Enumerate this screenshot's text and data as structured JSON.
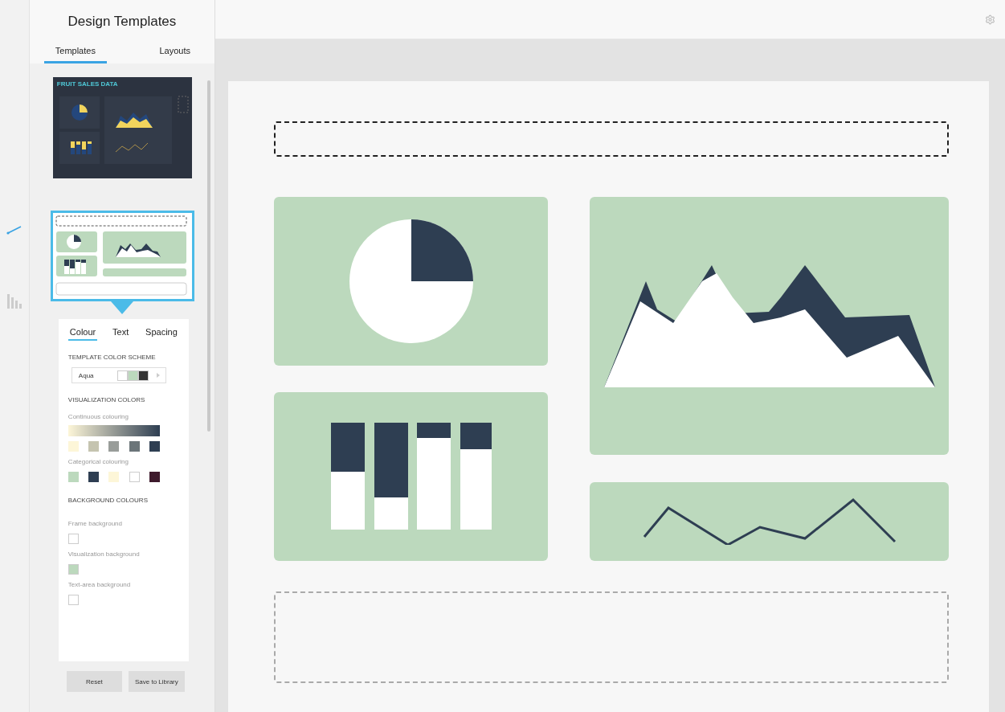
{
  "panel": {
    "title": "Design Templates",
    "tabs": [
      {
        "label": "Templates",
        "selected": true
      },
      {
        "label": "Layouts",
        "selected": false
      }
    ]
  },
  "templates": [
    {
      "kind": "dark",
      "title": "FRUIT SALES DATA",
      "selected": false
    },
    {
      "kind": "light",
      "selected": true
    }
  ],
  "settings": {
    "tabs": [
      {
        "label": "Colour",
        "selected": true
      },
      {
        "label": "Text",
        "selected": false
      },
      {
        "label": "Spacing",
        "selected": false
      }
    ],
    "scheme_heading": "TEMPLATE COLOR SCHEME",
    "scheme": {
      "name": "Aqua",
      "swatches": [
        {
          "color": "#ffffff"
        },
        {
          "color": "#bcd9bd"
        },
        {
          "color": "#333333"
        }
      ]
    },
    "viz_heading": "VISUALIZATION COLORS",
    "continuous_label": "Continuous colouring",
    "continuous": [
      {
        "color": "#fdf6d8"
      },
      {
        "color": "#c5c4b0"
      },
      {
        "color": "#999d9a"
      },
      {
        "color": "#6b7579"
      },
      {
        "color": "#2e3e52"
      }
    ],
    "categorical_label": "Categorical colouring",
    "categorical": [
      {
        "color": "#bcd9bd"
      },
      {
        "color": "#2e3e52"
      },
      {
        "color": "#fdf6d8"
      },
      {
        "color": "#ffffff"
      },
      {
        "color": "#3e1a2c"
      }
    ],
    "bg_heading": "BACKGROUND COLOURS",
    "backgrounds": [
      {
        "label": "Frame background",
        "color": "#ffffff"
      },
      {
        "label": "Visualization background",
        "color": "#bcd9bd"
      },
      {
        "label": "Text-area background",
        "color": "#ffffff"
      }
    ]
  },
  "buttons": [
    "Reset",
    "Save to Library"
  ],
  "sidebar_icons": [
    {
      "kind": "line",
      "selected": true
    },
    {
      "kind": "bars",
      "selected": false
    }
  ]
}
